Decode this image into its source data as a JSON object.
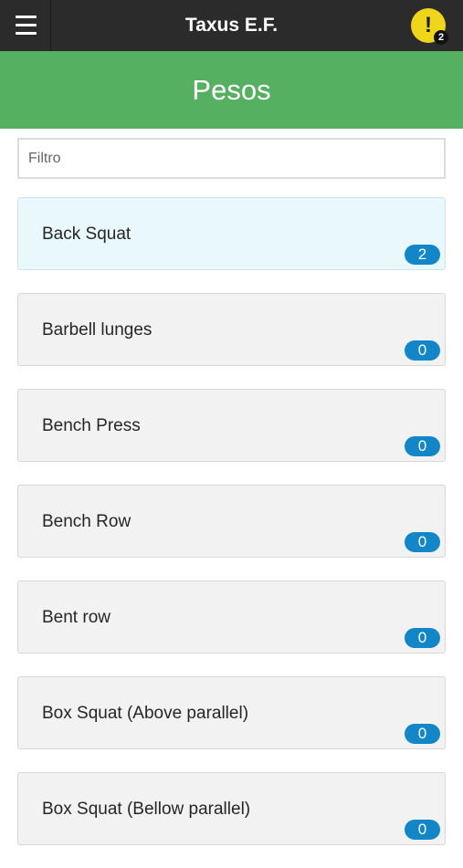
{
  "app": {
    "title": "Taxus E.F.",
    "notifications": {
      "icon": "alert-exclamation-icon",
      "mark": "!",
      "count": "2",
      "color": "#f0d61b"
    },
    "menu_icon": "hamburger-menu-icon"
  },
  "header": {
    "title": "Pesos",
    "color": "#56b062"
  },
  "filter": {
    "placeholder": "Filtro",
    "value": ""
  },
  "exercises": [
    {
      "name": "Back Squat",
      "count": "2",
      "highlighted": true
    },
    {
      "name": "Barbell lunges",
      "count": "0"
    },
    {
      "name": "Bench Press",
      "count": "0"
    },
    {
      "name": "Bench Row",
      "count": "0"
    },
    {
      "name": "Bent row",
      "count": "0"
    },
    {
      "name": "Box Squat (Above parallel)",
      "count": "0"
    },
    {
      "name": "Box Squat (Bellow parallel)",
      "count": "0"
    }
  ],
  "colors": {
    "topbar": "#2b2b2b",
    "badge": "#1286c7",
    "highlight": "#e8f8fc"
  }
}
